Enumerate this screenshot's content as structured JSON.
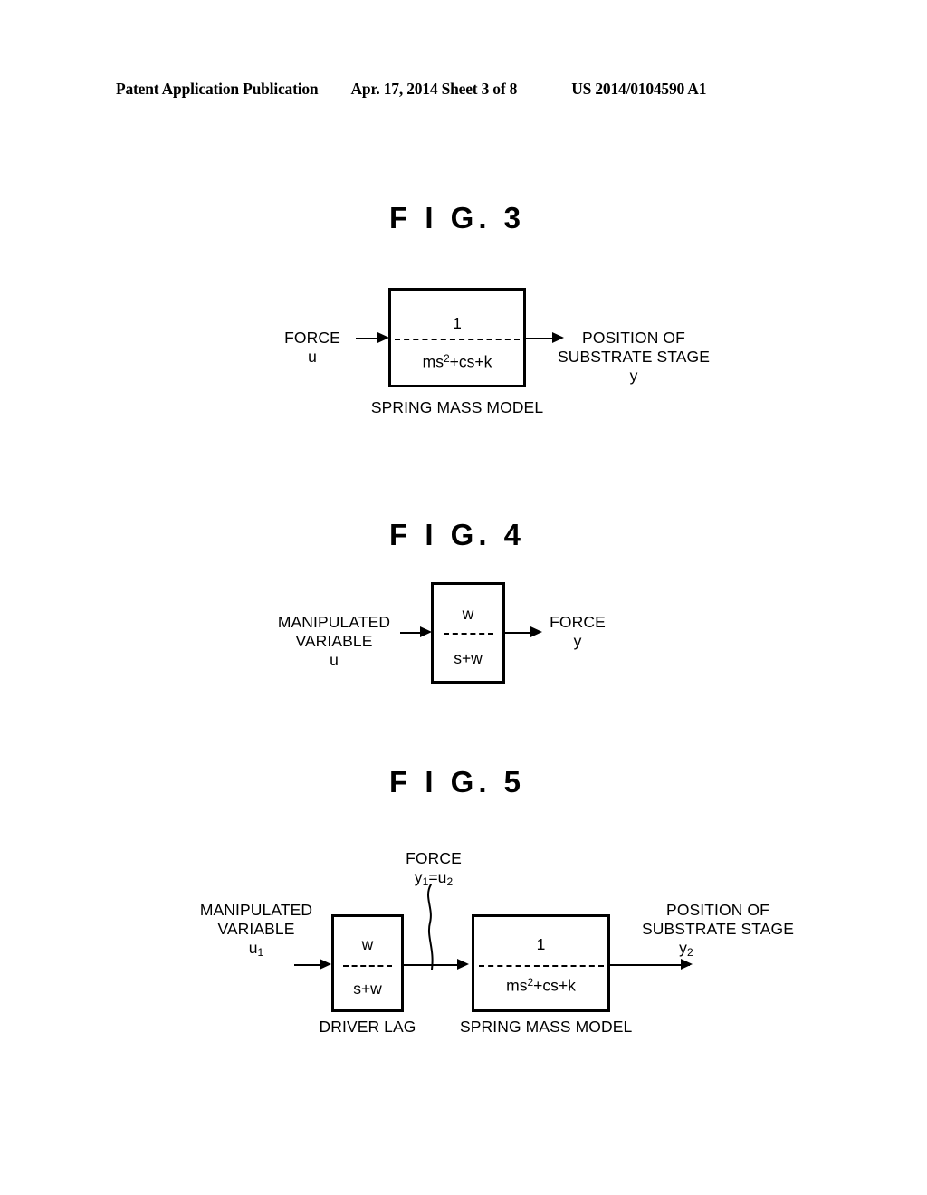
{
  "header": {
    "publication": "Patent Application Publication",
    "date_sheet": "Apr. 17, 2014  Sheet 3 of 8",
    "patent_number": "US 2014/0104590 A1"
  },
  "figures": [
    {
      "title": "F I G.  3",
      "input_label": "FORCE",
      "input_symbol": "u",
      "block": {
        "numerator": "1",
        "denominator_pre": "ms",
        "denominator_sup": "2",
        "denominator_post": "+cs+k",
        "caption": "SPRING MASS MODEL"
      },
      "output_line1": "POSITION OF",
      "output_line2": "SUBSTRATE STAGE",
      "output_symbol": "y"
    },
    {
      "title": "F I G.  4",
      "input_line1": "MANIPULATED",
      "input_line2": "VARIABLE",
      "input_symbol": "u",
      "block": {
        "numerator": "w",
        "denominator": "s+w"
      },
      "output_label": "FORCE",
      "output_symbol": "y"
    },
    {
      "title": "F I G.  5",
      "input_line1": "MANIPULATED",
      "input_line2": "VARIABLE",
      "input_symbol_base": "u",
      "input_symbol_sub": "1",
      "intermediate_label": "FORCE",
      "intermediate_symbol_y": "y",
      "intermediate_symbol_y_sub": "1",
      "intermediate_symbol_eq": "=u",
      "intermediate_symbol_u_sub": "2",
      "block1": {
        "numerator": "w",
        "denominator": "s+w",
        "caption": "DRIVER LAG"
      },
      "block2": {
        "numerator": "1",
        "denominator_pre": "ms",
        "denominator_sup": "2",
        "denominator_post": "+cs+k",
        "caption": "SPRING MASS MODEL"
      },
      "output_line1": "POSITION OF",
      "output_line2": "SUBSTRATE STAGE",
      "output_symbol_base": "y",
      "output_symbol_sub": "2"
    }
  ],
  "colors": {
    "ink": "#000000",
    "paper": "#ffffff"
  }
}
